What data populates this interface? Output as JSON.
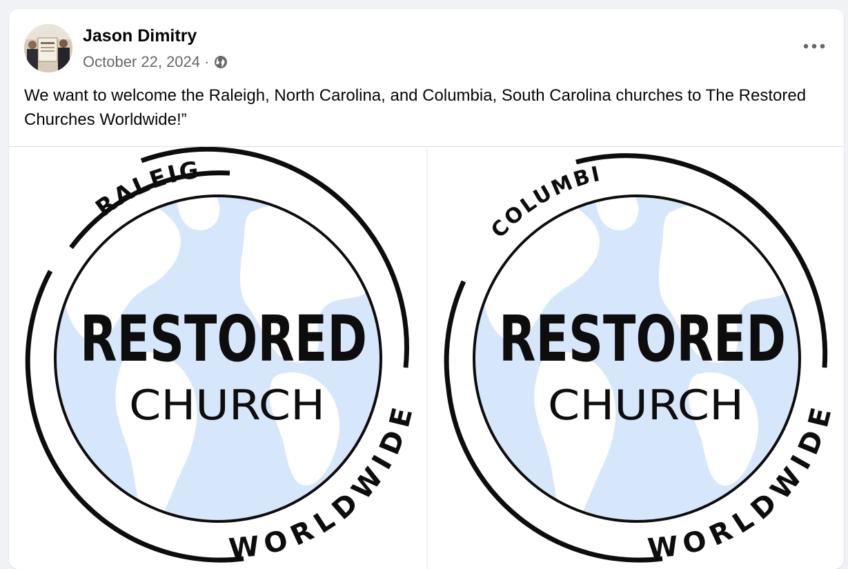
{
  "post": {
    "author": "Jason Dimitry",
    "date": "October 22, 2024",
    "separator": "·",
    "audience_icon": "globe-icon",
    "more_icon": "more-options-icon",
    "text": "We want to welcome the Raleigh, North Carolina, and Columbia, South Carolina churches to The Restored Churches Worldwide!”"
  },
  "photos": [
    {
      "location": "RALEIGH",
      "title": "RESTORED",
      "subtitle": "CHURCH",
      "ring_text": "WORLDWIDE"
    },
    {
      "location": "COLUMBIA",
      "title": "RESTORED",
      "subtitle": "CHURCH",
      "ring_text": "WORLDWIDE"
    }
  ],
  "colors": {
    "globe_fill": "#d6e6fb",
    "land_fill": "#ffffff",
    "ring": "#0d0d0d",
    "secondary_text": "#65676b"
  }
}
